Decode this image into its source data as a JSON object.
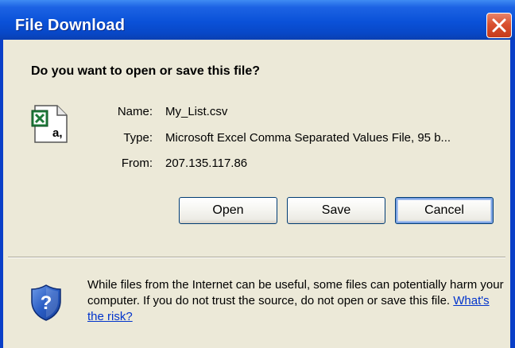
{
  "window": {
    "title": "File Download"
  },
  "dialog": {
    "question": "Do you want to open or save this file?",
    "file": {
      "name_label": "Name:",
      "name_value": "My_List.csv",
      "type_label": "Type:",
      "type_value": "Microsoft Excel Comma Separated Values File, 95 b...",
      "from_label": "From:",
      "from_value": "207.135.117.86",
      "icon": "excel-csv-file-icon"
    },
    "buttons": {
      "open": "Open",
      "save": "Save",
      "cancel": "Cancel"
    },
    "warning": {
      "text": "While files from the Internet can be useful, some files can potentially harm your computer. If you do not trust the source, do not open or save this file.",
      "link": "What's the risk?",
      "icon": "security-shield-icon"
    }
  },
  "colors": {
    "titlebar": "#0a51d8",
    "client_bg": "#ece9d8",
    "close_button": "#d9502f",
    "link": "#0033cc",
    "button_border": "#003c74"
  }
}
